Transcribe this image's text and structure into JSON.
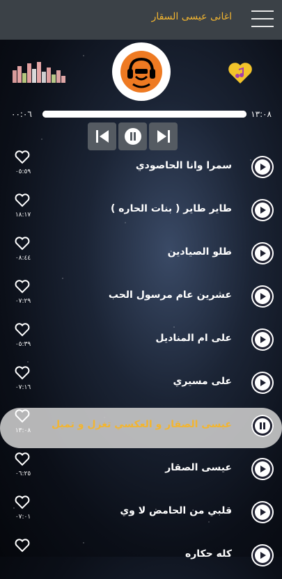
{
  "app": {
    "title": "اغانى عيسى السقار"
  },
  "player": {
    "elapsed": "٠٠:٠٦",
    "total": "١٣:٠٨",
    "progress_percent": 100
  },
  "songs": [
    {
      "title": "سمرا وانا الحاصودي",
      "duration": "٠٥:٥٩",
      "playing": false
    },
    {
      "title": "طاير طاير ( بنات الحاره )",
      "duration": "١٨:١٧",
      "playing": false
    },
    {
      "title": "طلو الصيادين",
      "duration": "٠٨:٤٤",
      "playing": false
    },
    {
      "title": "عشرين عام   مرسول الحب",
      "duration": "٠٧:٢٩",
      "playing": false
    },
    {
      "title": "على ام المناديل",
      "duration": "٠٥:٣٩",
      "playing": false
    },
    {
      "title": "على مسيري",
      "duration": "٠٧:١٦",
      "playing": false
    },
    {
      "title": "عيسى الصقار و العكسي تغزل و تميل",
      "duration": "١٣:٠٨",
      "playing": true
    },
    {
      "title": "عيسى الصقار",
      "duration": "٠٦:٢٥",
      "playing": false
    },
    {
      "title": "قلبي من الحامض لا وي",
      "duration": "٠٧:٠١",
      "playing": false
    },
    {
      "title": "كله حكاره",
      "duration": "",
      "playing": false
    }
  ],
  "colors": {
    "accent": "#f2b530",
    "topbar": "#3b4147",
    "logo": "#ee7a22"
  },
  "icons": {
    "menu": "hamburger-menu-icon",
    "equalizer": "equalizer-icon",
    "logo": "dj-headphones-icon",
    "favorite": "heart-music-note-icon",
    "previous": "skip-previous-icon",
    "pause": "pause-icon",
    "next": "skip-next-icon",
    "like": "heart-outline-icon",
    "play": "play-icon"
  }
}
